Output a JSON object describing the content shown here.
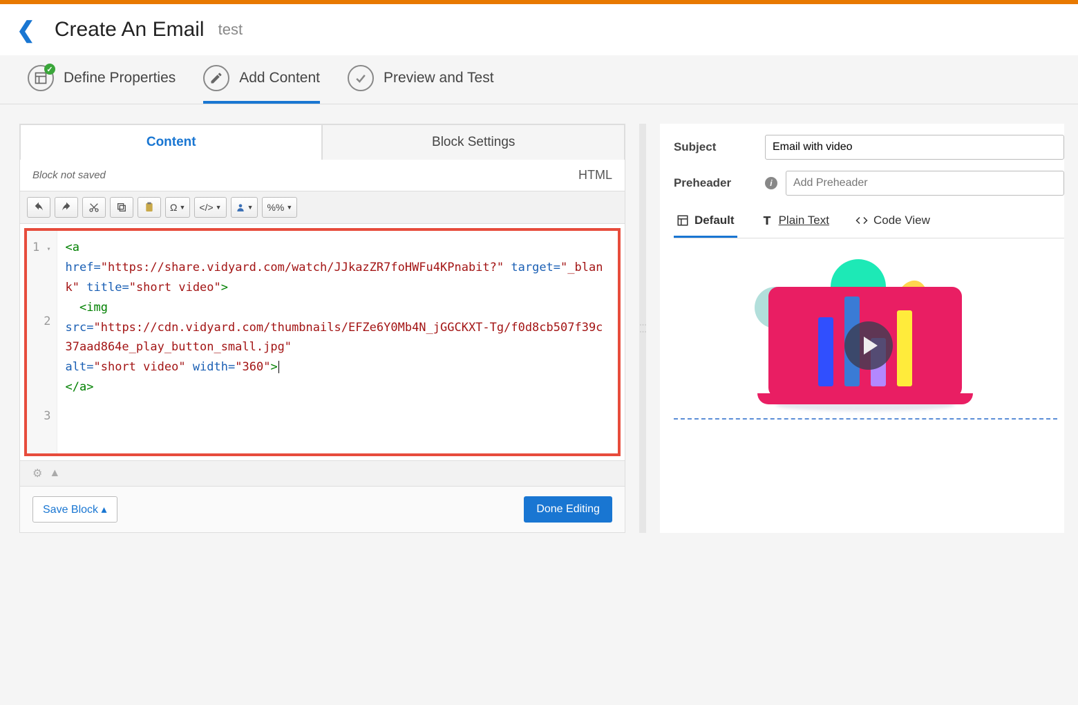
{
  "header": {
    "title": "Create An Email",
    "subtitle": "test"
  },
  "steps": {
    "define": "Define Properties",
    "add": "Add Content",
    "preview": "Preview and Test"
  },
  "subtabs": {
    "content": "Content",
    "block": "Block Settings"
  },
  "status": {
    "note": "Block not saved",
    "mode": "HTML"
  },
  "toolbar": {
    "omega": "Ω",
    "code": "</>",
    "var": "%%"
  },
  "code": {
    "lines": [
      "1",
      "2",
      "3"
    ],
    "a_open": "<a",
    "href_k": "href",
    "href_v": "\"https://share.vidyard.com/watch/JJkazZR7foHWFu4KPnabit?\"",
    "target_k": "target",
    "target_v": "\"_blank\"",
    "title_k": "title",
    "title_v": "\"short video\"",
    "gt": ">",
    "img_open": "<img",
    "src_k": "src",
    "src_v": "\"https://cdn.vidyard.com/thumbnails/EFZe6Y0Mb4N_jGGCKXT-Tg/f0d8cb507f39c37aad864e_play_button_small.jpg\"",
    "alt_k": "alt",
    "alt_v": "\"short video\"",
    "width_k": "width",
    "width_v": "\"360\"",
    "a_close": "</a>",
    "eq": "=",
    "fold": "▾"
  },
  "footer": {
    "save": "Save Block ▴",
    "done": "Done Editing"
  },
  "right": {
    "subject_label": "Subject",
    "subject_value": "Email with video",
    "preheader_label": "Preheader",
    "preheader_placeholder": "Add Preheader"
  },
  "viewtabs": {
    "default": "Default",
    "plain": "Plain Text",
    "code": "Code View"
  }
}
